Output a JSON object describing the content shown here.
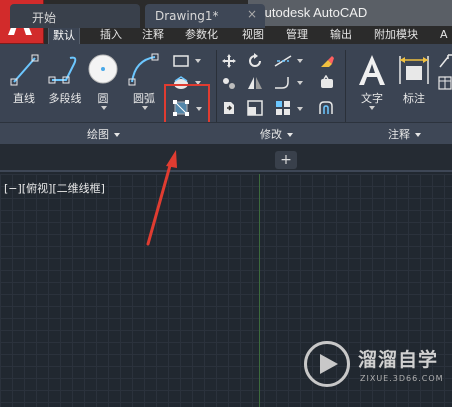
{
  "app": {
    "title": "Autodesk AutoCAD",
    "logo_letter": "A",
    "accent_color": "#d22b2b"
  },
  "quick_access": [
    {
      "icon": "new-file-icon"
    },
    {
      "icon": "open-folder-icon"
    },
    {
      "icon": "save-icon"
    },
    {
      "icon": "save-as-icon"
    },
    {
      "icon": "print-icon"
    },
    {
      "icon": "undo-icon"
    },
    {
      "icon": "redo-icon"
    }
  ],
  "ribbon_tabs": [
    "默认",
    "插入",
    "注释",
    "参数化",
    "视图",
    "管理",
    "输出",
    "附加模块",
    "A"
  ],
  "active_ribbon_tab": "默认",
  "draw_panel": {
    "title": "绘图",
    "tools": [
      "直线",
      "多段线",
      "圆",
      "圆弧"
    ]
  },
  "modify_panel": {
    "title": "修改"
  },
  "annotation_panel": {
    "title": "注释",
    "tools": [
      "文字",
      "标注"
    ]
  },
  "file_tabs": [
    {
      "label": "开始",
      "active": false
    },
    {
      "label": "Drawing1*",
      "active": true
    }
  ],
  "new_tab_label": "+",
  "close_label": "×",
  "viewport_label": "[−][俯视][二维线框]",
  "highlight_color": "#e03c31",
  "watermark": {
    "name": "溜溜自学",
    "url": "ZIXUE.3D66.COM"
  }
}
